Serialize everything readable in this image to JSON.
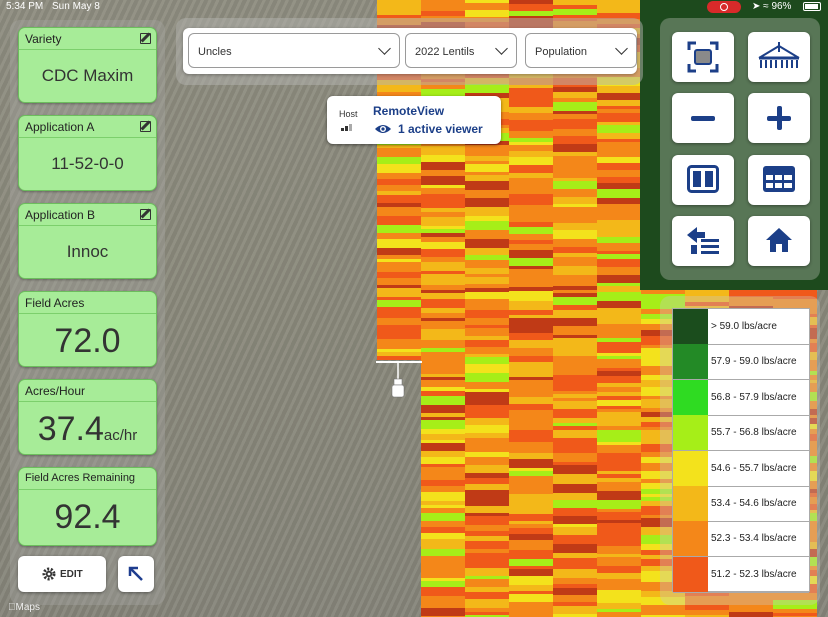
{
  "status_bar": {
    "time": "5:34 PM",
    "date": "Sun May 8",
    "battery": "96%"
  },
  "cards": [
    {
      "label": "Variety",
      "value": "CDC Maxim",
      "editable": true
    },
    {
      "label": "Application A",
      "value": "11-52-0-0",
      "editable": true
    },
    {
      "label": "Application B",
      "value": "Innoc",
      "editable": true
    },
    {
      "label": "Field Acres",
      "value": "72.0"
    },
    {
      "label": "Acres/Hour",
      "value": "37.4",
      "unit": "ac/hr"
    },
    {
      "label": "Field Acres Remaining",
      "value": "92.4"
    }
  ],
  "edit_button": {
    "label": "EDIT",
    "icon": "gear-icon"
  },
  "expand_button": {
    "icon": "arrow-up-left-icon"
  },
  "selectors": {
    "farm": "Uncles",
    "season": "2022 Lentils",
    "layer": "Population"
  },
  "remoteview": {
    "host_label": "Host",
    "title": "RemoteView",
    "viewers": "1 active viewer"
  },
  "tools": [
    "focus-frame-icon",
    "implement-icon",
    "zoom-out-icon",
    "zoom-in-icon",
    "split-view-icon",
    "table-view-icon",
    "layers-swap-icon",
    "home-icon"
  ],
  "legend": [
    {
      "range": "> 59.0 lbs/acre",
      "color": "#1b4d1d"
    },
    {
      "range": "57.9 - 59.0 lbs/acre",
      "color": "#238a26"
    },
    {
      "range": "56.8 - 57.9 lbs/acre",
      "color": "#2fdb22"
    },
    {
      "range": "55.7 - 56.8 lbs/acre",
      "color": "#a6ee18"
    },
    {
      "range": "54.6 - 55.7 lbs/acre",
      "color": "#f3e21c"
    },
    {
      "range": "53.4 - 54.6 lbs/acre",
      "color": "#f3b819"
    },
    {
      "range": "52.3 - 53.4 lbs/acre",
      "color": "#f48719"
    },
    {
      "range": "51.2 - 52.3 lbs/acre",
      "color": "#f0591a"
    }
  ],
  "map_attribution": "Maps"
}
